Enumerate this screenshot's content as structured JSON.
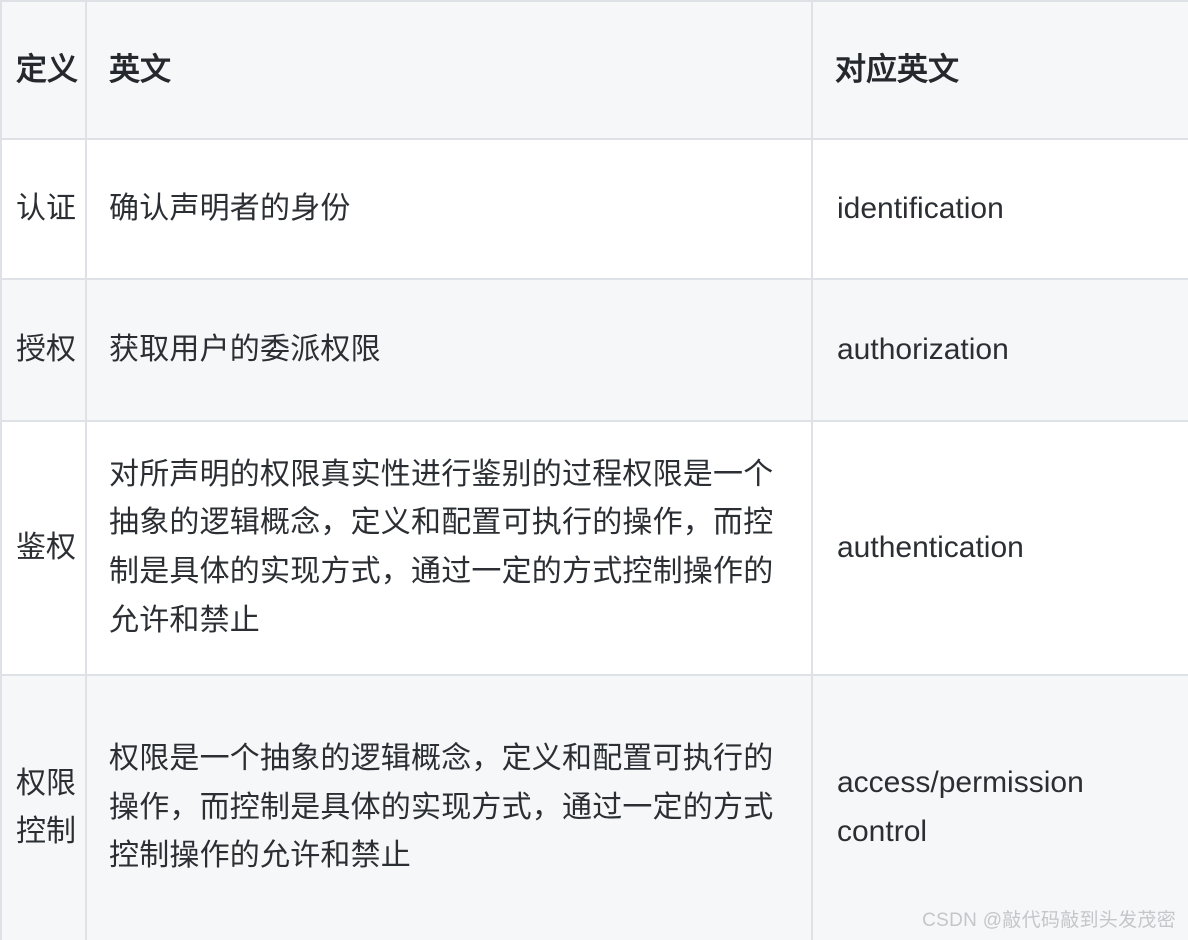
{
  "table": {
    "headers": [
      {
        "key": "definition",
        "label": "定义"
      },
      {
        "key": "chinese",
        "label": "英文"
      },
      {
        "key": "english",
        "label": "对应英文"
      }
    ],
    "rows": [
      {
        "definition": "认证",
        "chinese": "确认声明者的身份",
        "english": "identification"
      },
      {
        "definition": "授权",
        "chinese": "获取用户的委派权限",
        "english": "authorization"
      },
      {
        "definition": "鉴权",
        "chinese": "对所声明的权限真实性进行鉴别的过程权限是一个抽象的逻辑概念，定义和配置可执行的操作，而控制是具体的实现方式，通过一定的方式控制操作的允许和禁止",
        "english": "authentication"
      },
      {
        "definition": "权限控制",
        "chinese": "权限是一个抽象的逻辑概念，定义和配置可执行的操作，而控制是具体的实现方式，通过一定的方式控制操作的允许和禁止",
        "english": "access/permission control"
      }
    ]
  },
  "watermark": {
    "text": "CSDN @敲代码敲到头发茂密"
  },
  "colors": {
    "border": "#dee2e6",
    "header_bg": "#f6f7f8",
    "row_alt_bg": "#f6f7f8",
    "row_bg": "#ffffff",
    "text": "#2b2f33",
    "header_text": "#25292e",
    "watermark": "#c3c6ca"
  }
}
